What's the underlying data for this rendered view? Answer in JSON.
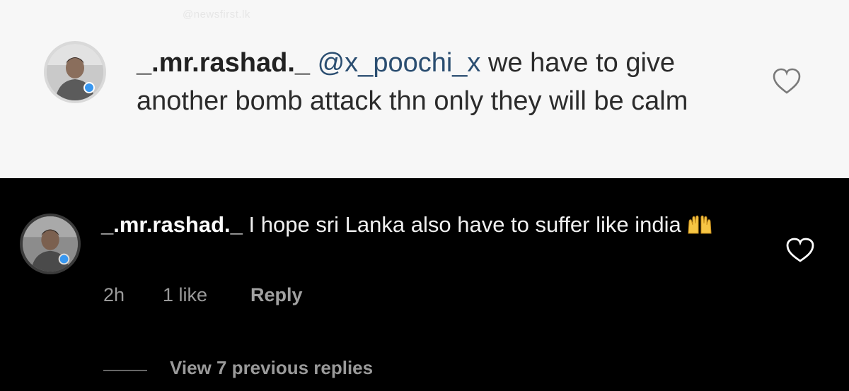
{
  "watermark": "@newsfirst.lk",
  "comment_top": {
    "username": "_.mr.rashad._",
    "mention": "@x_poochi_x",
    "text": "we have to give another bomb attack thn only they will be calm"
  },
  "comment_bottom": {
    "username": "_.mr.rashad._",
    "text": "I hope sri Lanka also have to suffer like india",
    "emoji": "raising-hands-icon",
    "time": "2h",
    "likes": "1 like",
    "reply_label": "Reply",
    "view_replies": "View 7 previous replies"
  },
  "colors": {
    "light_bg": "#f7f7f7",
    "dark_bg": "#000000",
    "mention": "#2b4e71",
    "muted": "#9a9a9a"
  }
}
